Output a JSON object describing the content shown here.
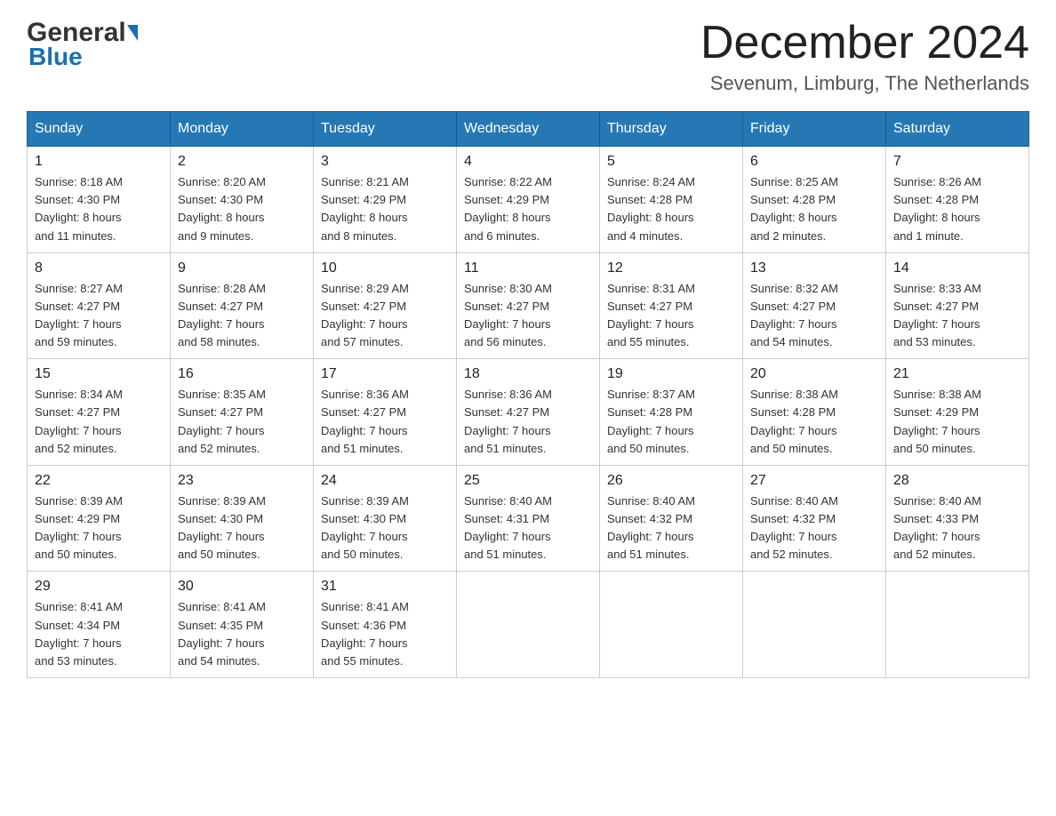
{
  "header": {
    "logo_general": "General",
    "logo_blue": "Blue",
    "main_title": "December 2024",
    "subtitle": "Sevenum, Limburg, The Netherlands"
  },
  "days_of_week": [
    "Sunday",
    "Monday",
    "Tuesday",
    "Wednesday",
    "Thursday",
    "Friday",
    "Saturday"
  ],
  "weeks": [
    [
      {
        "day": "1",
        "sunrise": "Sunrise: 8:18 AM",
        "sunset": "Sunset: 4:30 PM",
        "daylight": "Daylight: 8 hours",
        "daylight2": "and 11 minutes."
      },
      {
        "day": "2",
        "sunrise": "Sunrise: 8:20 AM",
        "sunset": "Sunset: 4:30 PM",
        "daylight": "Daylight: 8 hours",
        "daylight2": "and 9 minutes."
      },
      {
        "day": "3",
        "sunrise": "Sunrise: 8:21 AM",
        "sunset": "Sunset: 4:29 PM",
        "daylight": "Daylight: 8 hours",
        "daylight2": "and 8 minutes."
      },
      {
        "day": "4",
        "sunrise": "Sunrise: 8:22 AM",
        "sunset": "Sunset: 4:29 PM",
        "daylight": "Daylight: 8 hours",
        "daylight2": "and 6 minutes."
      },
      {
        "day": "5",
        "sunrise": "Sunrise: 8:24 AM",
        "sunset": "Sunset: 4:28 PM",
        "daylight": "Daylight: 8 hours",
        "daylight2": "and 4 minutes."
      },
      {
        "day": "6",
        "sunrise": "Sunrise: 8:25 AM",
        "sunset": "Sunset: 4:28 PM",
        "daylight": "Daylight: 8 hours",
        "daylight2": "and 2 minutes."
      },
      {
        "day": "7",
        "sunrise": "Sunrise: 8:26 AM",
        "sunset": "Sunset: 4:28 PM",
        "daylight": "Daylight: 8 hours",
        "daylight2": "and 1 minute."
      }
    ],
    [
      {
        "day": "8",
        "sunrise": "Sunrise: 8:27 AM",
        "sunset": "Sunset: 4:27 PM",
        "daylight": "Daylight: 7 hours",
        "daylight2": "and 59 minutes."
      },
      {
        "day": "9",
        "sunrise": "Sunrise: 8:28 AM",
        "sunset": "Sunset: 4:27 PM",
        "daylight": "Daylight: 7 hours",
        "daylight2": "and 58 minutes."
      },
      {
        "day": "10",
        "sunrise": "Sunrise: 8:29 AM",
        "sunset": "Sunset: 4:27 PM",
        "daylight": "Daylight: 7 hours",
        "daylight2": "and 57 minutes."
      },
      {
        "day": "11",
        "sunrise": "Sunrise: 8:30 AM",
        "sunset": "Sunset: 4:27 PM",
        "daylight": "Daylight: 7 hours",
        "daylight2": "and 56 minutes."
      },
      {
        "day": "12",
        "sunrise": "Sunrise: 8:31 AM",
        "sunset": "Sunset: 4:27 PM",
        "daylight": "Daylight: 7 hours",
        "daylight2": "and 55 minutes."
      },
      {
        "day": "13",
        "sunrise": "Sunrise: 8:32 AM",
        "sunset": "Sunset: 4:27 PM",
        "daylight": "Daylight: 7 hours",
        "daylight2": "and 54 minutes."
      },
      {
        "day": "14",
        "sunrise": "Sunrise: 8:33 AM",
        "sunset": "Sunset: 4:27 PM",
        "daylight": "Daylight: 7 hours",
        "daylight2": "and 53 minutes."
      }
    ],
    [
      {
        "day": "15",
        "sunrise": "Sunrise: 8:34 AM",
        "sunset": "Sunset: 4:27 PM",
        "daylight": "Daylight: 7 hours",
        "daylight2": "and 52 minutes."
      },
      {
        "day": "16",
        "sunrise": "Sunrise: 8:35 AM",
        "sunset": "Sunset: 4:27 PM",
        "daylight": "Daylight: 7 hours",
        "daylight2": "and 52 minutes."
      },
      {
        "day": "17",
        "sunrise": "Sunrise: 8:36 AM",
        "sunset": "Sunset: 4:27 PM",
        "daylight": "Daylight: 7 hours",
        "daylight2": "and 51 minutes."
      },
      {
        "day": "18",
        "sunrise": "Sunrise: 8:36 AM",
        "sunset": "Sunset: 4:27 PM",
        "daylight": "Daylight: 7 hours",
        "daylight2": "and 51 minutes."
      },
      {
        "day": "19",
        "sunrise": "Sunrise: 8:37 AM",
        "sunset": "Sunset: 4:28 PM",
        "daylight": "Daylight: 7 hours",
        "daylight2": "and 50 minutes."
      },
      {
        "day": "20",
        "sunrise": "Sunrise: 8:38 AM",
        "sunset": "Sunset: 4:28 PM",
        "daylight": "Daylight: 7 hours",
        "daylight2": "and 50 minutes."
      },
      {
        "day": "21",
        "sunrise": "Sunrise: 8:38 AM",
        "sunset": "Sunset: 4:29 PM",
        "daylight": "Daylight: 7 hours",
        "daylight2": "and 50 minutes."
      }
    ],
    [
      {
        "day": "22",
        "sunrise": "Sunrise: 8:39 AM",
        "sunset": "Sunset: 4:29 PM",
        "daylight": "Daylight: 7 hours",
        "daylight2": "and 50 minutes."
      },
      {
        "day": "23",
        "sunrise": "Sunrise: 8:39 AM",
        "sunset": "Sunset: 4:30 PM",
        "daylight": "Daylight: 7 hours",
        "daylight2": "and 50 minutes."
      },
      {
        "day": "24",
        "sunrise": "Sunrise: 8:39 AM",
        "sunset": "Sunset: 4:30 PM",
        "daylight": "Daylight: 7 hours",
        "daylight2": "and 50 minutes."
      },
      {
        "day": "25",
        "sunrise": "Sunrise: 8:40 AM",
        "sunset": "Sunset: 4:31 PM",
        "daylight": "Daylight: 7 hours",
        "daylight2": "and 51 minutes."
      },
      {
        "day": "26",
        "sunrise": "Sunrise: 8:40 AM",
        "sunset": "Sunset: 4:32 PM",
        "daylight": "Daylight: 7 hours",
        "daylight2": "and 51 minutes."
      },
      {
        "day": "27",
        "sunrise": "Sunrise: 8:40 AM",
        "sunset": "Sunset: 4:32 PM",
        "daylight": "Daylight: 7 hours",
        "daylight2": "and 52 minutes."
      },
      {
        "day": "28",
        "sunrise": "Sunrise: 8:40 AM",
        "sunset": "Sunset: 4:33 PM",
        "daylight": "Daylight: 7 hours",
        "daylight2": "and 52 minutes."
      }
    ],
    [
      {
        "day": "29",
        "sunrise": "Sunrise: 8:41 AM",
        "sunset": "Sunset: 4:34 PM",
        "daylight": "Daylight: 7 hours",
        "daylight2": "and 53 minutes."
      },
      {
        "day": "30",
        "sunrise": "Sunrise: 8:41 AM",
        "sunset": "Sunset: 4:35 PM",
        "daylight": "Daylight: 7 hours",
        "daylight2": "and 54 minutes."
      },
      {
        "day": "31",
        "sunrise": "Sunrise: 8:41 AM",
        "sunset": "Sunset: 4:36 PM",
        "daylight": "Daylight: 7 hours",
        "daylight2": "and 55 minutes."
      },
      null,
      null,
      null,
      null
    ]
  ],
  "accent_color": "#2678b5"
}
